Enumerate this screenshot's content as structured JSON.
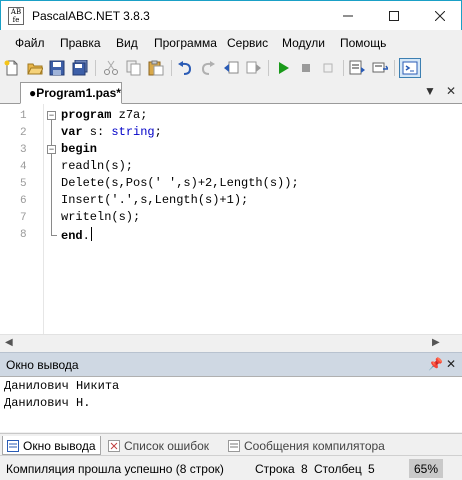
{
  "window": {
    "title": "PascalABC.NET 3.8.3",
    "icon_text": "AB\nfe"
  },
  "menu": [
    "Файл",
    "Правка",
    "Вид",
    "Программа",
    "Сервис",
    "Модули",
    "Помощь"
  ],
  "toolbar": {
    "icons": [
      "new-file-icon",
      "open-folder-icon",
      "save-icon",
      "save-all-icon",
      "cut-icon",
      "copy-icon",
      "paste-icon",
      "undo-icon",
      "redo-icon",
      "navigate-back-icon",
      "navigate-forward-icon",
      "run-icon",
      "stop-icon",
      "compile-icon",
      "step-icon",
      "debug-icon",
      "output-window-icon"
    ]
  },
  "tab": {
    "label": "●Program1.pas*"
  },
  "editor": {
    "line_numbers": [
      "1",
      "2",
      "3",
      "4",
      "5",
      "6",
      "7",
      "8"
    ],
    "line1_kw": "program",
    "line1_rest": " z7a;",
    "line2_kw": "var",
    "line2_mid": " s: ",
    "line2_type": "string",
    "line2_end": ";",
    "line3_kw": "begin",
    "line4": "readln(s);",
    "line5": "Delete(s,Pos(' ',s)+2,Length(s));",
    "line6": "Insert('.',s,Length(s)+1);",
    "line7": "writeln(s);",
    "line8_kw": "end",
    "line8_end": "."
  },
  "output_panel": {
    "title": "Окно вывода",
    "lines": [
      "Данилович Никита",
      "Данилович Н."
    ]
  },
  "bottom_tabs": [
    "Окно вывода",
    "Список ошибок",
    "Сообщения компилятора"
  ],
  "status": {
    "message": "Компиляция прошла успешно (8 строк)",
    "row_label": "Строка",
    "row_value": "8",
    "col_label": "Столбец",
    "col_value": "5",
    "zoom": "65%"
  },
  "colors": {
    "accent": "#1aa0c6",
    "panel_header": "#cfd8e3",
    "type_color": "#0000c8",
    "run_green": "#1a9a1a"
  }
}
